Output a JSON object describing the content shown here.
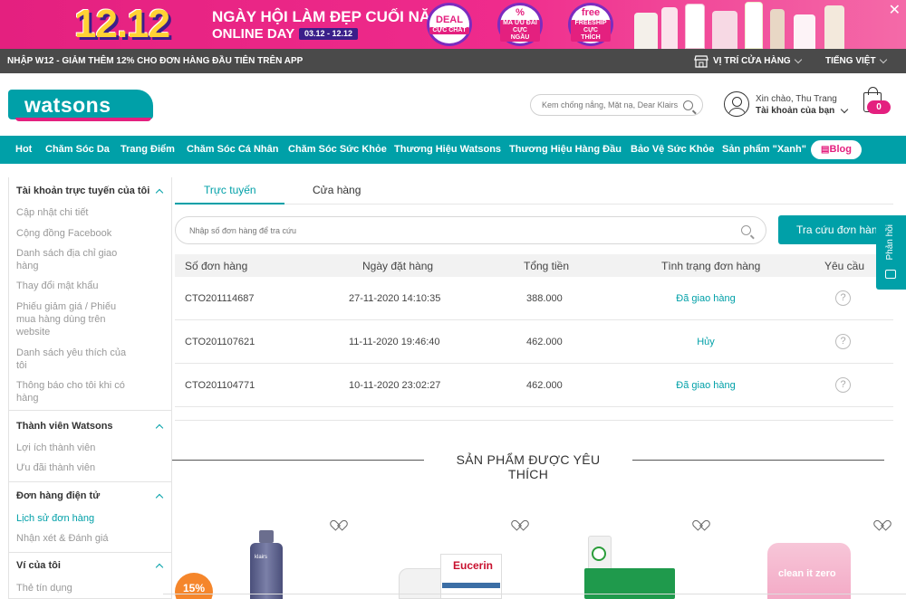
{
  "promo": {
    "big_number": "12.12",
    "title": "NGÀY HỘI LÀM ĐẸP CUỐI NĂM",
    "subtitle": "ONLINE DAY",
    "date_range": "03.12 - 12.12",
    "badges": [
      {
        "line1": "DEAL",
        "line2": "CỰC CHẤT"
      },
      {
        "line1": "%",
        "line2": "MÃ ƯU ĐÃI CỰC NGẦU"
      },
      {
        "line1": "free",
        "line2": "FREESHIP CỰC THÍCH"
      }
    ],
    "close": "✕"
  },
  "topbar": {
    "promo_text": "NHẬP W12 - GIẢM THÊM 12% CHO ĐƠN HÀNG ĐẦU TIÊN TRÊN APP",
    "store_locator": "VỊ TRÍ CỬA HÀNG",
    "language": "TIẾNG VIỆT"
  },
  "header": {
    "logo": "watsons",
    "search_placeholder": "Kem chống nắng, Mặt nạ, Dear Klairs",
    "greeting": "Xin chào, Thu Trang",
    "account_link": "Tài khoản của bạn",
    "cart_count": "0"
  },
  "nav": {
    "items": [
      "Hot",
      "Chăm Sóc Da",
      "Trang Điểm",
      "Chăm Sóc Cá Nhân",
      "Chăm Sóc Sức Khỏe",
      "Thương Hiệu Watsons",
      "Thương Hiệu Hàng Đầu",
      "Bảo Vệ Sức Khỏe",
      "Sản phẩm \"Xanh\""
    ],
    "blog": "Blog"
  },
  "sidebar": {
    "groups": [
      {
        "title": "Tài khoản trực tuyến của tôi",
        "links": [
          "Cập nhật chi tiết",
          "Cộng đồng Facebook",
          "Danh sách địa chỉ giao hàng",
          "Thay đổi mật khẩu",
          "Phiếu giảm giá / Phiếu mua hàng dùng trên website",
          "Danh sách yêu thích của tôi",
          "Thông báo cho tôi khi có hàng"
        ]
      },
      {
        "title": "Thành viên Watsons",
        "links": [
          "Lợi ích thành viên",
          "Ưu đãi thành viên"
        ]
      },
      {
        "title": "Đơn hàng điện tử",
        "links": [
          "Lịch sử đơn hàng",
          "Nhận xét & Đánh giá"
        ]
      },
      {
        "title": "Ví của tôi",
        "links": [
          "Thẻ tín dụng"
        ]
      }
    ]
  },
  "tabs": {
    "online": "Trực tuyến",
    "store": "Cửa hàng"
  },
  "order_search": {
    "placeholder": "Nhập số đơn hàng để tra cứu",
    "button": "Tra cứu đơn hàng"
  },
  "orders": {
    "headers": [
      "Số đơn hàng",
      "Ngày đặt hàng",
      "Tổng tiền",
      "Tình trạng đơn hàng",
      "Yêu cầu"
    ],
    "rows": [
      {
        "id": "CTO201114687",
        "date": "27-11-2020 14:10:35",
        "total": "388.000",
        "status": "Đã giao hàng",
        "help": "?"
      },
      {
        "id": "CTO201107621",
        "date": "11-11-2020 19:46:40",
        "total": "462.000",
        "status": "Hủy",
        "help": "?"
      },
      {
        "id": "CTO201104771",
        "date": "10-11-2020 23:02:27",
        "total": "462.000",
        "status": "Đã giao hàng",
        "help": "?"
      }
    ]
  },
  "favorites": {
    "title": "SẢN PHẨM ĐƯỢC YÊU THÍCH",
    "discount": "15%",
    "products": [
      {
        "label": "klairs"
      },
      {
        "label": "Eucerin"
      },
      {
        "label": ""
      },
      {
        "label": "clean it zero"
      }
    ]
  },
  "side_feedback": {
    "label": "Phản hồi"
  },
  "colors": {
    "brand": "#00a0a8",
    "accent": "#e4207f",
    "topbar": "#4a4a4a",
    "discount": "#f5862b"
  }
}
